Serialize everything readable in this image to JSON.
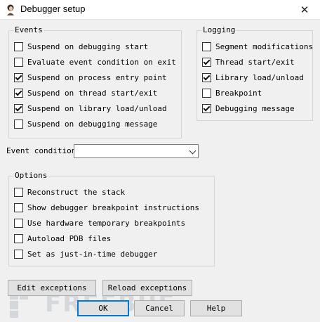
{
  "window": {
    "title": "Debugger setup",
    "close_glyph": "✕"
  },
  "events": {
    "legend": "Events",
    "items": [
      {
        "label": "Suspend on debugging start",
        "checked": false
      },
      {
        "label": "Evaluate event condition on exit",
        "checked": false
      },
      {
        "label": "Suspend on process entry point",
        "checked": true
      },
      {
        "label": "Suspend on thread start/exit",
        "checked": true
      },
      {
        "label": "Suspend on library load/unload",
        "checked": true
      },
      {
        "label": "Suspend on debugging message",
        "checked": false
      }
    ]
  },
  "logging": {
    "legend": "Logging",
    "items": [
      {
        "label": "Segment modifications",
        "checked": false
      },
      {
        "label": "Thread start/exit",
        "checked": true
      },
      {
        "label": "Library load/unload",
        "checked": true
      },
      {
        "label": "Breakpoint",
        "checked": false
      },
      {
        "label": "Debugging message",
        "checked": true
      }
    ]
  },
  "event_condition": {
    "label": "Event condition",
    "value": ""
  },
  "options": {
    "legend": "Options",
    "items": [
      {
        "label": "Reconstruct the stack",
        "checked": false
      },
      {
        "label": "Show debugger breakpoint instructions",
        "checked": false
      },
      {
        "label": "Use hardware temporary breakpoints",
        "checked": false
      },
      {
        "label": "Autoload PDB files",
        "checked": false
      },
      {
        "label": "Set as just-in-time debugger",
        "checked": false
      }
    ]
  },
  "buttons": {
    "edit_exceptions": "Edit exceptions",
    "reload_exceptions": "Reload exceptions",
    "ok": "OK",
    "cancel": "Cancel",
    "help": "Help"
  },
  "watermark": {
    "text": "FREEBUF"
  }
}
